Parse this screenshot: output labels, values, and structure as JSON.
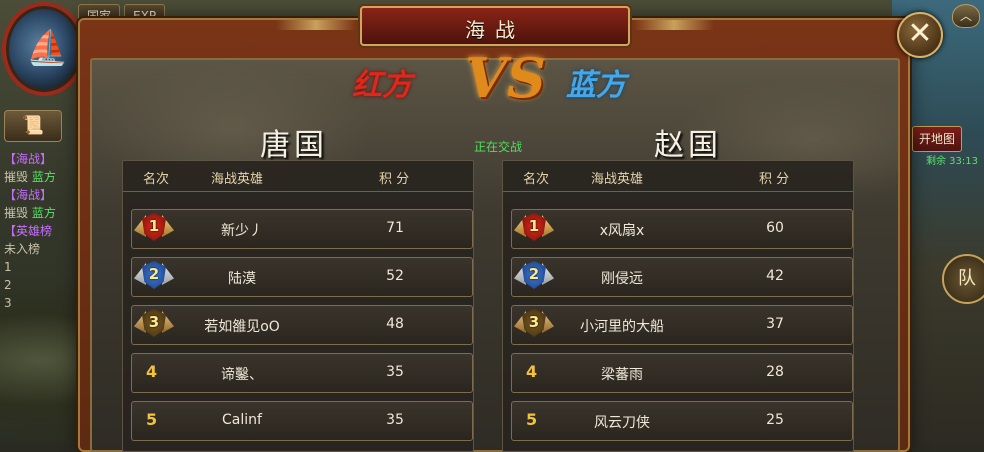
{
  "hud": {
    "top_tabs": [
      "国家",
      "EXP"
    ],
    "chat_lines": [
      {
        "tag": "【海战】",
        "text": "摧毁",
        "highlight": "蓝方"
      },
      {
        "tag": "【海战】",
        "text": "摧毁",
        "highlight": "蓝方"
      },
      {
        "tag": "【英雄榜",
        "text": "",
        "highlight": ""
      }
    ],
    "chat_rank_rows": [
      "未入榜",
      "1",
      "2",
      "3"
    ],
    "map_button": "开地图",
    "map_info": "剩余 33:13",
    "team_button": "队"
  },
  "dialog": {
    "title": "海战",
    "close_symbol": "✕",
    "red_side_label": "红方",
    "vs_label": "VS",
    "blue_side_label": "蓝方",
    "battle_state": "正在交战",
    "red_nation": "唐国",
    "blue_nation": "赵国"
  },
  "table_headers": {
    "rank": "名次",
    "hero": "海战英雄",
    "score": "积 分"
  },
  "red_rankings": [
    {
      "rank": "1",
      "name": "新少丿",
      "score": "71",
      "medal": "gold"
    },
    {
      "rank": "2",
      "name": "陆漠",
      "score": "52",
      "medal": "silver"
    },
    {
      "rank": "3",
      "name": "若如雒见oO",
      "score": "48",
      "medal": "bronze"
    },
    {
      "rank": "4",
      "name": "谛鑿、",
      "score": "35",
      "medal": ""
    },
    {
      "rank": "5",
      "name": "Calinf",
      "score": "35",
      "medal": ""
    }
  ],
  "blue_rankings": [
    {
      "rank": "1",
      "name": "x风扇x",
      "score": "60",
      "medal": "gold"
    },
    {
      "rank": "2",
      "name": "刚侵远",
      "score": "42",
      "medal": "silver"
    },
    {
      "rank": "3",
      "name": "小河里的大船",
      "score": "37",
      "medal": "bronze"
    },
    {
      "rank": "4",
      "name": "梁蕃雨",
      "score": "28",
      "medal": ""
    },
    {
      "rank": "5",
      "name": "风云刀侠",
      "score": "25",
      "medal": ""
    }
  ],
  "colors": {
    "red_side": "#e0271c",
    "blue_side": "#44a7e8",
    "state_green": "#4fe05a",
    "rank_gold": "#f2c23b"
  }
}
